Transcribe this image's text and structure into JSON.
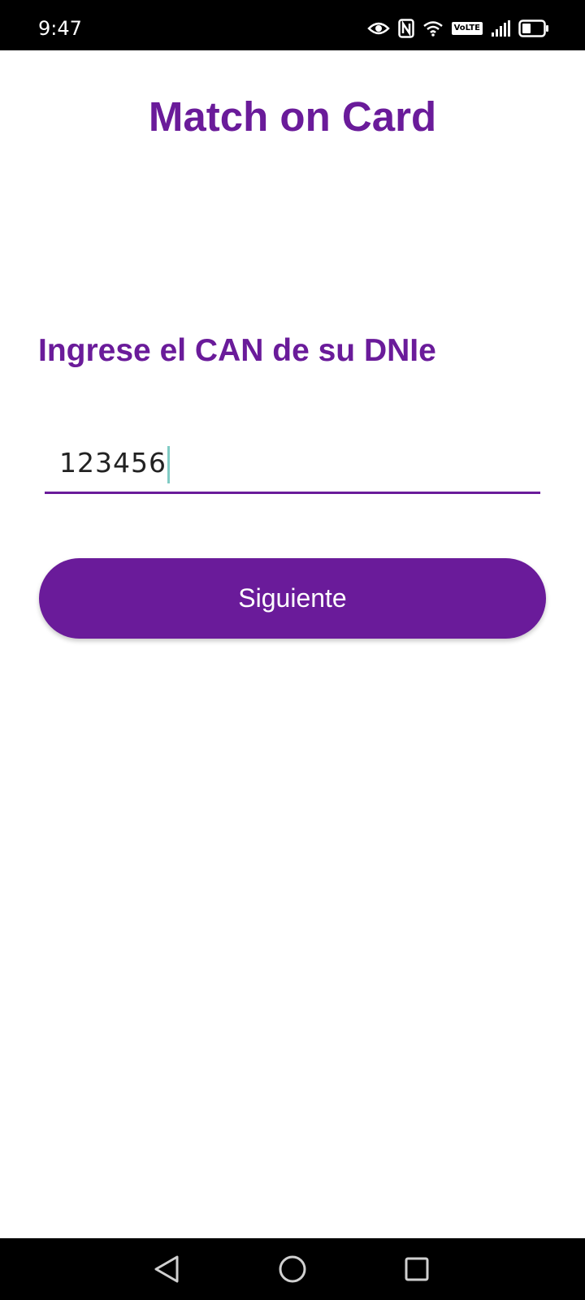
{
  "status_bar": {
    "time": "9:47",
    "volte": "VoLTE",
    "icons": [
      "eye-icon",
      "nfc-icon",
      "wifi-icon",
      "volte-icon",
      "signal-icon",
      "battery-icon"
    ]
  },
  "app": {
    "title": "Match on Card",
    "prompt": "Ingrese el CAN de su DNIe",
    "can_input": {
      "value": "123456"
    },
    "next_button": "Siguiente",
    "colors": {
      "accent": "#6a1b9a",
      "caret": "#80cbc4"
    }
  },
  "nav_bar": {
    "icons": [
      "back-icon",
      "home-icon",
      "recents-icon"
    ]
  }
}
